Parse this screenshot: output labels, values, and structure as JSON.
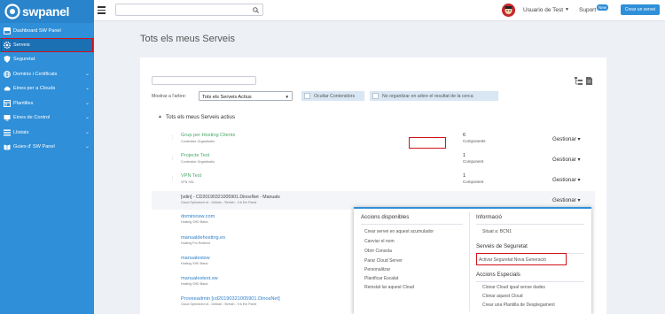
{
  "brand": {
    "name": "swpanel"
  },
  "sidebar": {
    "items": [
      {
        "label": "Dashboard SW Panel",
        "icon": "dashboard-icon",
        "expandable": false
      },
      {
        "label": "Serveis",
        "icon": "gear-icon",
        "expandable": false,
        "active": true
      },
      {
        "label": "Seguretat",
        "icon": "shield-icon",
        "expandable": false
      },
      {
        "label": "Dominis i Certificats",
        "icon": "globe-icon",
        "expandable": true
      },
      {
        "label": "Eines per a Clouds",
        "icon": "cloud-icon",
        "expandable": true
      },
      {
        "label": "Plantilles",
        "icon": "template-icon",
        "expandable": true
      },
      {
        "label": "Eines de Control",
        "icon": "control-icon",
        "expandable": true
      },
      {
        "label": "Llistats",
        "icon": "list-icon",
        "expandable": true
      },
      {
        "label": "Guies d' SW Panel",
        "icon": "book-icon",
        "expandable": true
      }
    ]
  },
  "topbar": {
    "search": {
      "value": "",
      "placeholder": ""
    },
    "user": "Usuario de Test",
    "support": "Suport",
    "support_badge": "New",
    "create_button": "Crear un servei"
  },
  "page": {
    "title": "Tots els meus Serveis"
  },
  "filters": {
    "search": {
      "value": "",
      "placeholder": ""
    },
    "show_label": "Mostrar a l'arbre:",
    "show_value": "Tots els Serveis Actius",
    "hide_containers": "Ocultar Contenidors",
    "no_organize": "No organitzar en arbre el resultat de la cerca"
  },
  "section": {
    "title": "Tots els meus Serveis actius"
  },
  "groups": [
    {
      "name": "Grup per Hosting Clients",
      "sub": "Contenidor Organitzatiu",
      "count": "6",
      "count_label": "Components",
      "manage": "Gestionar"
    },
    {
      "name": "Projecte Test",
      "sub": "Contenidor Organitzatiu",
      "count": "1",
      "count_label": "Component",
      "manage": "Gestionar"
    },
    {
      "name": "VPN Test",
      "sub": "VPN SSL",
      "count": "1",
      "count_label": "Component",
      "manage": "Gestionar"
    }
  ],
  "services": [
    {
      "name": "[vdin] - CD20190321005901.DinosNet - Manuals",
      "sub": "Cloud Optimized v4 - Debian - Stretch - 9.6 Em Panel",
      "manage": "Gestionar"
    },
    {
      "name": "dominiosw.com",
      "sub": "Hosting SHD Basic"
    },
    {
      "name": "manualdehosting.es",
      "sub": "Hosting Pro Redirect"
    },
    {
      "name": "manualestsw",
      "sub": "Hosting SHD Basic"
    },
    {
      "name": "manualestest.sw",
      "sub": "Hosting SHD Basic"
    },
    {
      "name": "Proveeadmin [cd20190321005901.DinosNet]",
      "sub": "Cloud Optimized v4 - Debian - Stretch - 9.6 Em Panel"
    }
  ],
  "dropdown": {
    "actions_title": "Accions disponibles",
    "actions": [
      "Crear servei en aquest acumulador",
      "Canviar el nom",
      "Obrir Consola",
      "Parar Cloud Server",
      "Personalitzar",
      "Planificar Escalat",
      "Reinstal·lar aquest Cloud"
    ],
    "info_title": "Informació",
    "info_location": "Situat a: BCN1",
    "security_title": "Serveis de Seguretat",
    "security_item": "Activar Seguretat Nova Generació",
    "special_title": "Accions Especials",
    "special_items": [
      "Clonar Cloud igual sense dades",
      "Clonar aquest Cloud",
      "Crear una Plantilla de Desplegament"
    ]
  },
  "colors": {
    "brand": "#2f8fd8",
    "sidebar_active": "#1b6fb3",
    "highlight": "#d0121a",
    "group_name": "#4aa76a",
    "service_name": "#2f7fc7"
  }
}
